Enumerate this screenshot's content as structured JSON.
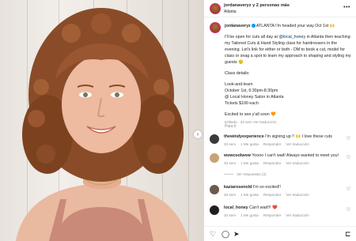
{
  "header": {
    "username": "jordanaveryz y 2 personas más",
    "location": "Atlanta",
    "more_icon": "more-horizontal-icon"
  },
  "caption": {
    "username": "jordanaveryz",
    "intro": "ATLANTA I'm headed your way Oct 1st",
    "p1_a": "I'll be open for cuts all day at ",
    "p1_tag": "@local_honey",
    "p1_b": " in Atlanta then teaching my Tailored Cuts & Hand Styling class for hairdressers in the evening. Let's link for either or both - DM to book a cut, model for class or snag a spot to learn my approach to shaping and styling my guests",
    "class_label": "Class details:",
    "look_learn": "Look-and-learn",
    "date_time": "October 1st, 6:30pm-8:30pm",
    "salon": "@ Local Honey Salon in Atlanta",
    "tickets": "Tickets $100 each",
    "closing": "Excited to see y'all soon",
    "meta": "Editado · 33 sem   Ver traducción"
  },
  "section_label": "Para ti",
  "comments": [
    {
      "username": "thewindyexperience",
      "text": "I'm signing up !! 🙌 I love these cuts",
      "time": "33 sem",
      "likes": "1 Me gusta",
      "reply": "Responder",
      "translate": "Ver traducción",
      "color": "#3a3a3a"
    },
    {
      "username": "wowcoolwow",
      "text": "Yoooo I can't wait! Always wanted to meet you!",
      "time": "33 sem",
      "likes": "1 Me gusta",
      "reply": "Responder",
      "translate": "Ver traducción",
      "replies": "Ver respuestas (2)",
      "color": "#c9a27a"
    },
    {
      "username": "kaziarosenold",
      "text": "I'm so excited!!",
      "time": "33 sem",
      "likes": "1 Me gusta",
      "reply": "Responder",
      "translate": "Ver traducción",
      "color": "#6b5a4e"
    },
    {
      "username": "local_honey",
      "text": "Can't wait!!! ❤️",
      "time": "33 sem",
      "likes": "1 Me gusta",
      "reply": "Responder",
      "translate": "Ver traducción",
      "color": "#1f1f1f"
    }
  ],
  "nav": {
    "next_label": "›"
  },
  "actions": {
    "like": "♡",
    "comment": "◯",
    "share": "➤",
    "save": "⊏"
  }
}
